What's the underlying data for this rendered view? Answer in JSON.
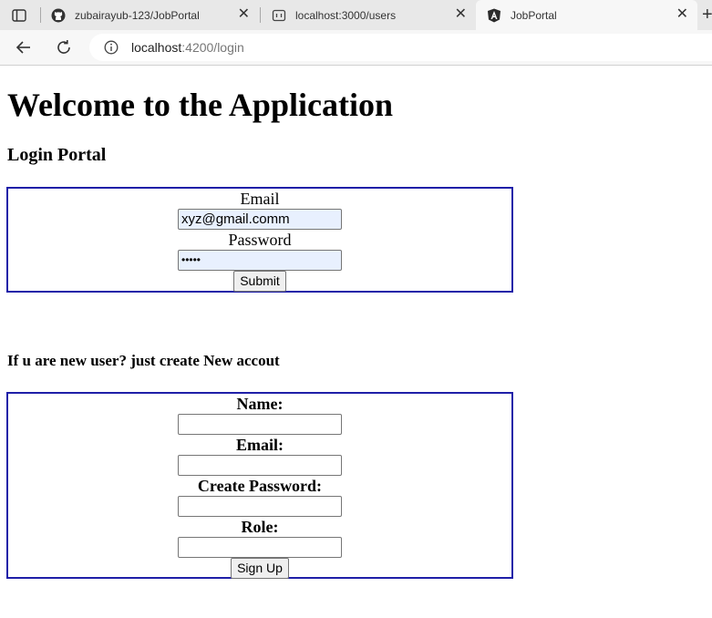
{
  "browser": {
    "tabs": [
      {
        "title": "zubairayub-123/JobPortal",
        "icon": "github-icon"
      },
      {
        "title": "localhost:3000/users",
        "icon": "generic-page-icon"
      },
      {
        "title": "JobPortal",
        "icon": "angular-icon",
        "active": true
      }
    ],
    "close_glyph": "✕",
    "new_tab_glyph": "+",
    "url_host": "localhost",
    "url_path": ":4200/login"
  },
  "page": {
    "title": "Welcome to the Application",
    "login_heading": "Login Portal",
    "login": {
      "email_label": "Email",
      "email_value": "xyz@gmail.comm",
      "password_label": "Password",
      "password_value": "•••••",
      "submit_label": "Submit"
    },
    "new_user_heading": "If u are new user? just create New accout",
    "signup": {
      "name_label": "Name:",
      "email_label": "Email:",
      "password_label": "Create Password:",
      "role_label": "Role:",
      "signup_label": "Sign Up"
    }
  },
  "colors": {
    "box_border": "#1f1fa8",
    "autofill_bg": "#e8f0fe"
  }
}
